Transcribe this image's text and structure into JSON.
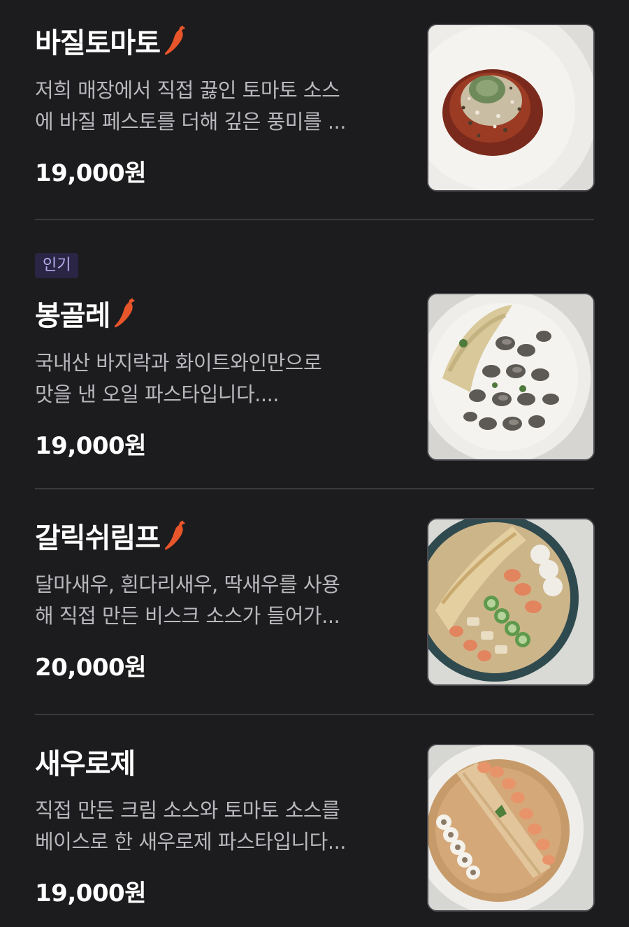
{
  "menu": {
    "items": [
      {
        "badge": "",
        "name": "바질토마토",
        "spicy": true,
        "description_lines": [
          "저희 매장에서 직접 끓인 토마토 소스",
          "에 바질 페스토를 더해 깊은 풍미를 ..."
        ],
        "price": "19,000원",
        "image": "basil-tomato-pasta-photo"
      },
      {
        "badge": "인기",
        "name": "봉골레",
        "spicy": true,
        "description_lines": [
          "국내산 바지락과 화이트와인만으로",
          "맛을 낸 오일 파스타입니다...."
        ],
        "price": "19,000원",
        "image": "vongole-pasta-photo"
      },
      {
        "badge": "",
        "name": "갈릭쉬림프",
        "spicy": true,
        "description_lines": [
          "달마새우, 흰다리새우, 딱새우를 사용",
          "해 직접 만든 비스크 소스가 들어가..."
        ],
        "price": "20,000원",
        "image": "garlic-shrimp-pasta-photo"
      },
      {
        "badge": "",
        "name": "새우로제",
        "spicy": false,
        "description_lines": [
          "직접 만든 크림 소스와 토마토 소스를",
          "베이스로 한 새우로제 파스타입니다..."
        ],
        "price": "19,000원",
        "image": "shrimp-rose-pasta-photo"
      }
    ]
  },
  "colors": {
    "background": "#1c1c1e",
    "title": "#ffffff",
    "description": "#b8b8bd",
    "divider": "#3a3a3e",
    "badge_bg": "#2a2545",
    "badge_text": "#b7b0f0",
    "pepper": "#e8552a"
  },
  "icons": {
    "spicy": "chili-pepper-icon"
  }
}
